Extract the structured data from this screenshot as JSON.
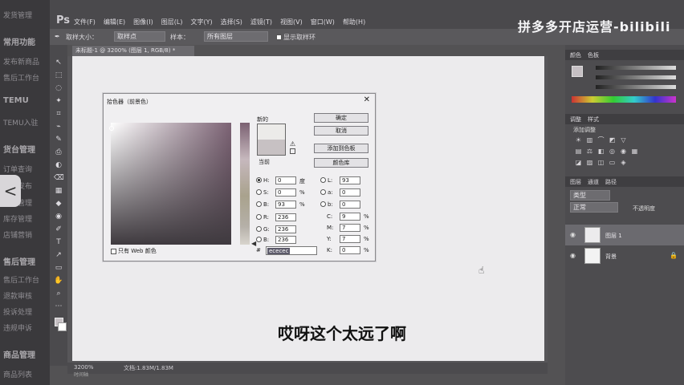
{
  "left_panel": {
    "items": [
      "发货管理",
      "常用功能",
      "发布新商品",
      "售后工作台",
      "TEMU",
      "TEMU入驻",
      "货台管理",
      "订单查询",
      "商品发布",
      "商品管理",
      "库存管理",
      "店铺营销",
      "售后管理",
      "售后工作台",
      "退款审核",
      "投诉处理",
      "违规申诉",
      "商品管理",
      "商品列表"
    ],
    "collapse_glyph": "<"
  },
  "ps": {
    "logo": "Ps",
    "menus": [
      "文件(F)",
      "编辑(E)",
      "图像(I)",
      "图层(L)",
      "文字(Y)",
      "选择(S)",
      "滤镜(T)",
      "视图(V)",
      "窗口(W)",
      "帮助(H)"
    ],
    "options": {
      "sample_size_label": "取样大小：",
      "sample_size_value": "取样点",
      "sample_label": "样本：",
      "sample_value": "所有图层",
      "show_ring_label": "显示取样环"
    },
    "doc_tab": "未标题-1 @ 3200% (图层 1, RGB/8) *",
    "status": {
      "zoom": "3200%",
      "doc": "文档:1.83M/1.83M",
      "timeline": "时间轴"
    },
    "tools": [
      "↖",
      "⬚",
      "◌",
      "✦",
      "⌗",
      "⌁",
      "✎",
      "⎙",
      "◐",
      "⌫",
      "▦",
      "◆",
      "◉",
      "✐",
      "T",
      "↗",
      "▭",
      "✋",
      "⌕",
      "⋯"
    ]
  },
  "panels": {
    "color_tabs": [
      "颜色",
      "色板"
    ],
    "adjust_tabs": [
      "调整",
      "样式"
    ],
    "adjust_title": "添加调整",
    "layers_tabs": [
      "图层",
      "通道",
      "路径"
    ],
    "kind_label": "类型",
    "blend_mode": "正常",
    "opacity_label": "不透明度",
    "layers": [
      {
        "name": "图层 1"
      },
      {
        "name": "背景"
      }
    ]
  },
  "picker": {
    "title": "拾色器（前景色）",
    "new_label": "新的",
    "current_label": "当前",
    "buttons": [
      "确定",
      "取消",
      "添加到色板",
      "颜色库"
    ],
    "web_only": "只有 Web 颜色",
    "hsb": [
      {
        "label": "H:",
        "value": "0",
        "unit": "度",
        "on": true
      },
      {
        "label": "S:",
        "value": "0",
        "unit": "%",
        "on": false
      },
      {
        "label": "B:",
        "value": "93",
        "unit": "%",
        "on": false
      }
    ],
    "rgb": [
      {
        "label": "R:",
        "value": "236"
      },
      {
        "label": "G:",
        "value": "236"
      },
      {
        "label": "B:",
        "value": "236"
      }
    ],
    "lab": [
      {
        "label": "L:",
        "value": "93"
      },
      {
        "label": "a:",
        "value": "0"
      },
      {
        "label": "b:",
        "value": "0"
      }
    ],
    "cmyk": [
      {
        "label": "C:",
        "value": "9",
        "unit": "%"
      },
      {
        "label": "M:",
        "value": "7",
        "unit": "%"
      },
      {
        "label": "Y:",
        "value": "7",
        "unit": "%"
      },
      {
        "label": "K:",
        "value": "0",
        "unit": "%"
      }
    ],
    "hex_label": "#",
    "hex_value": "ececec",
    "new_color": "#ecebe9",
    "current_color": "#c7c1c3"
  },
  "watermark": "拼多多开店运营-bilibili",
  "subtitle": "哎呀这个太远了啊"
}
